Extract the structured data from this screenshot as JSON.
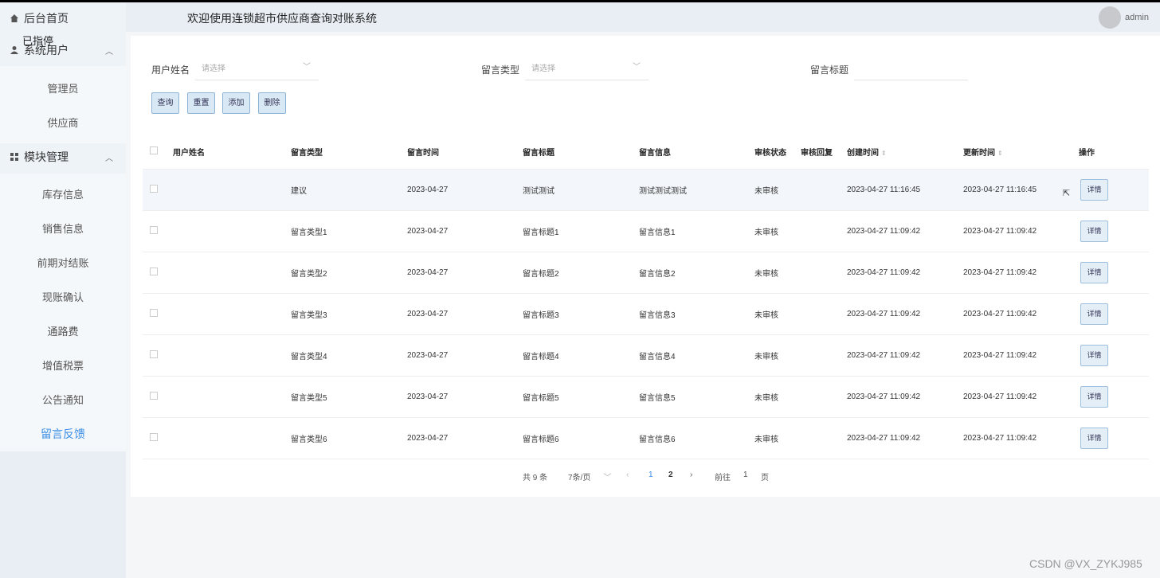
{
  "header": {
    "title": "欢迎使用连锁超市供应商查询对账系统",
    "user": "admin"
  },
  "sidebar": {
    "home": "后台首页",
    "ghost_text": "已指停",
    "groups": [
      {
        "label": "系统用户",
        "icon": "user-icon",
        "items": [
          "管理员",
          "供应商"
        ]
      },
      {
        "label": "模块管理",
        "icon": "grid-icon",
        "items": [
          "库存信息",
          "销售信息",
          "前期对结账",
          "现账确认",
          "通路费",
          "增值税票",
          "公告通知",
          "留言反馈"
        ]
      }
    ],
    "active": "留言反馈"
  },
  "filters": {
    "username_label": "用户姓名",
    "username_placeholder": "请选择",
    "type_label": "留言类型",
    "type_placeholder": "请选择",
    "title_label": "留言标题"
  },
  "buttons": {
    "query": "查询",
    "reset": "重置",
    "add": "添加",
    "delete": "删除"
  },
  "table": {
    "columns": [
      "用户姓名",
      "留言类型",
      "留言时间",
      "留言标题",
      "留言信息",
      "审核状态",
      "审核回复",
      "创建时间",
      "更新时间",
      "操作"
    ],
    "detail_label": "详情",
    "rows": [
      {
        "user": "",
        "type": "建议",
        "time": "2023-04-27",
        "title": "测试测试",
        "info": "测试测试测试",
        "status": "未审核",
        "reply": "",
        "created": "2023-04-27 11:16:45",
        "updated": "2023-04-27 11:16:45"
      },
      {
        "user": "",
        "type": "留言类型1",
        "time": "2023-04-27",
        "title": "留言标题1",
        "info": "留言信息1",
        "status": "未审核",
        "reply": "",
        "created": "2023-04-27 11:09:42",
        "updated": "2023-04-27 11:09:42"
      },
      {
        "user": "",
        "type": "留言类型2",
        "time": "2023-04-27",
        "title": "留言标题2",
        "info": "留言信息2",
        "status": "未审核",
        "reply": "",
        "created": "2023-04-27 11:09:42",
        "updated": "2023-04-27 11:09:42"
      },
      {
        "user": "",
        "type": "留言类型3",
        "time": "2023-04-27",
        "title": "留言标题3",
        "info": "留言信息3",
        "status": "未审核",
        "reply": "",
        "created": "2023-04-27 11:09:42",
        "updated": "2023-04-27 11:09:42"
      },
      {
        "user": "",
        "type": "留言类型4",
        "time": "2023-04-27",
        "title": "留言标题4",
        "info": "留言信息4",
        "status": "未审核",
        "reply": "",
        "created": "2023-04-27 11:09:42",
        "updated": "2023-04-27 11:09:42"
      },
      {
        "user": "",
        "type": "留言类型5",
        "time": "2023-04-27",
        "title": "留言标题5",
        "info": "留言信息5",
        "status": "未审核",
        "reply": "",
        "created": "2023-04-27 11:09:42",
        "updated": "2023-04-27 11:09:42"
      },
      {
        "user": "",
        "type": "留言类型6",
        "time": "2023-04-27",
        "title": "留言标题6",
        "info": "留言信息6",
        "status": "未审核",
        "reply": "",
        "created": "2023-04-27 11:09:42",
        "updated": "2023-04-27 11:09:42"
      }
    ]
  },
  "pagination": {
    "total": "共 9 条",
    "page_size": "7条/页",
    "pages": [
      "1",
      "2"
    ],
    "current": "1",
    "goto_prefix": "前往",
    "goto_value": "1",
    "goto_suffix": "页"
  },
  "watermark": "CSDN @VX_ZYKJ985"
}
